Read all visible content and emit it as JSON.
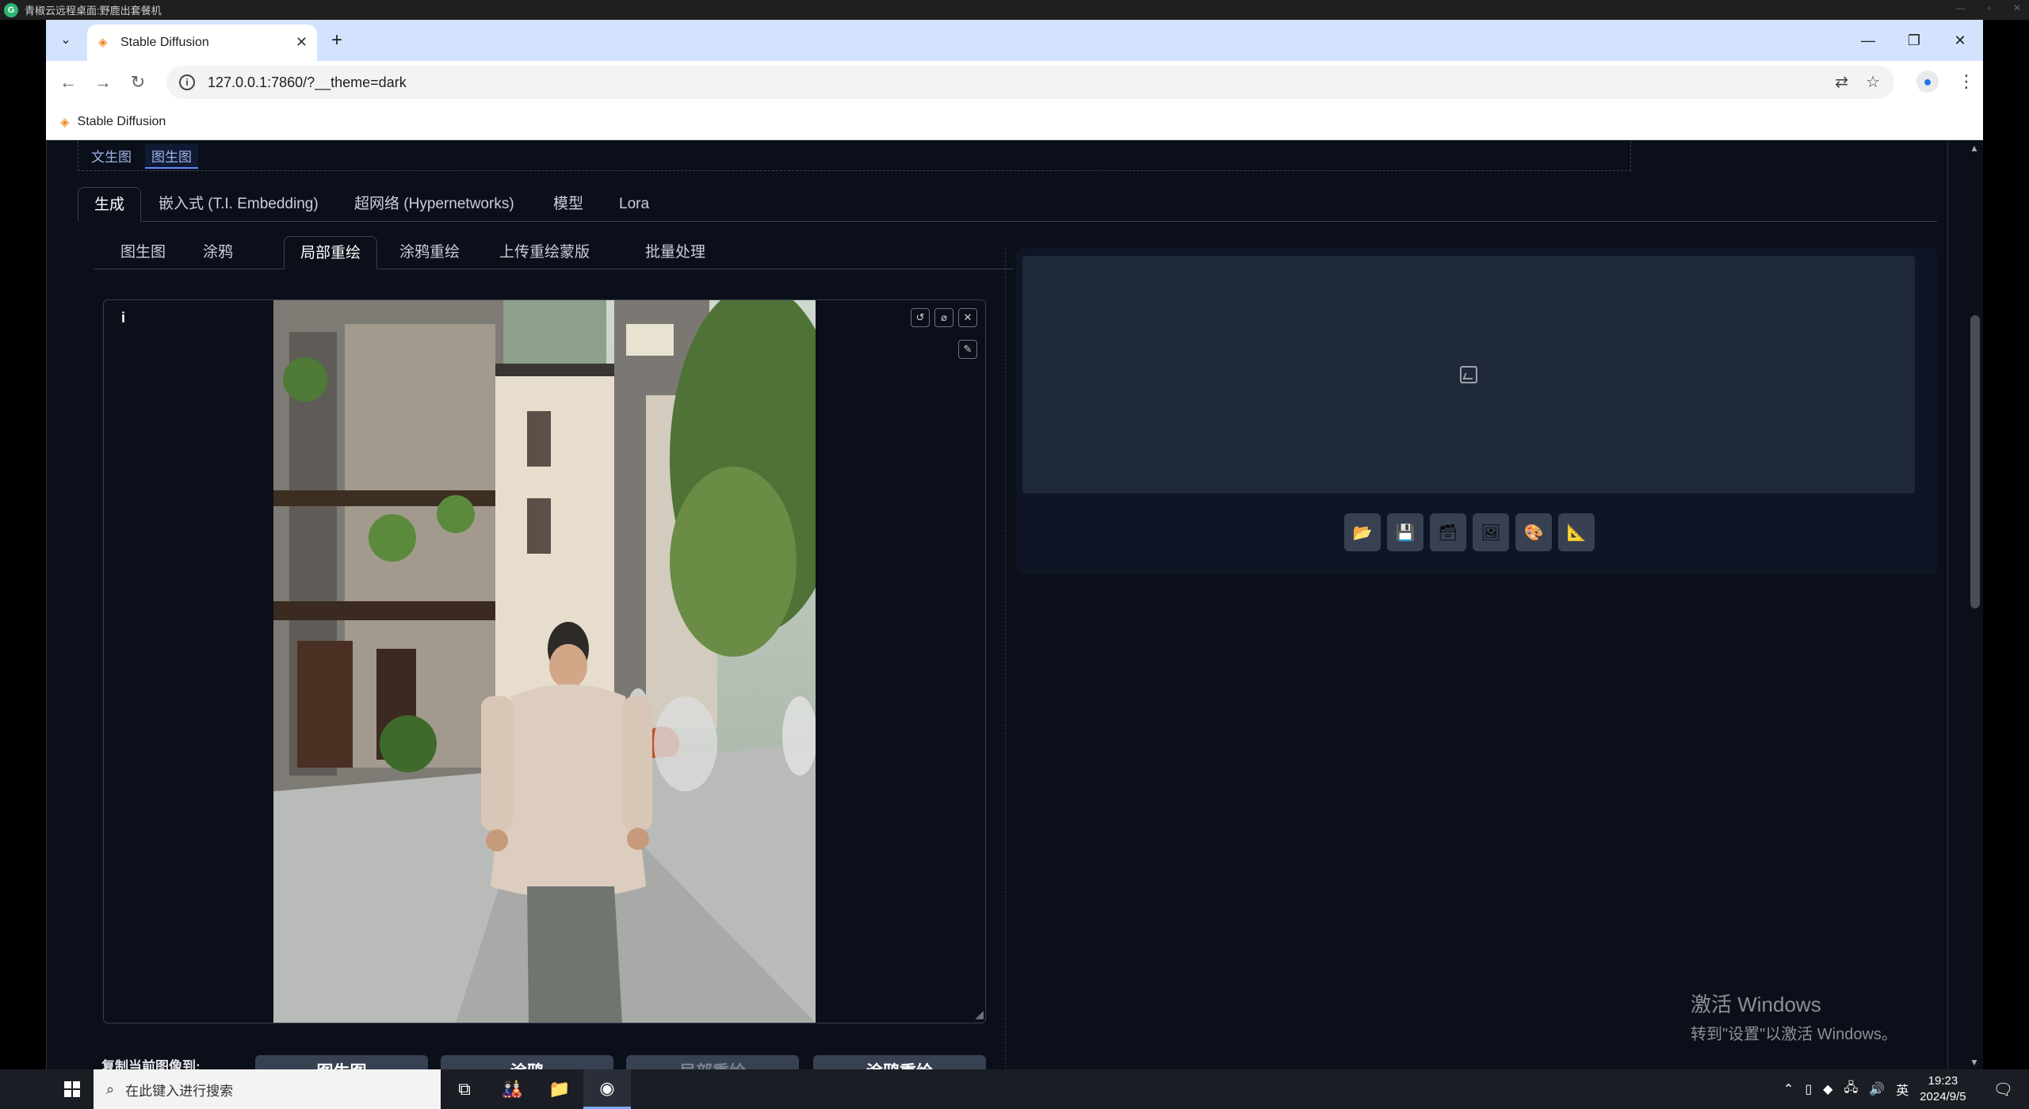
{
  "outer_window": {
    "title": "青椒云远程桌面:野鹿出套餐机",
    "logo_glyph": "G"
  },
  "browser": {
    "tab_title": "Stable Diffusion",
    "url": "127.0.0.1:7860/?__theme=dark",
    "bookmark": "Stable Diffusion"
  },
  "app": {
    "mode_tabs": [
      "文生图",
      "图生图"
    ],
    "active_mode": "图生图",
    "main_tabs": [
      "生成",
      "嵌入式 (T.I. Embedding)",
      "超网络 (Hypernetworks)",
      "模型",
      "Lora"
    ],
    "active_main_tab": "生成",
    "sub_tabs": [
      "图生图",
      "涂鸦",
      "局部重绘",
      "涂鸦重绘",
      "上传重绘蒙版",
      "批量处理"
    ],
    "active_sub_tab": "局部重绘",
    "editor": {
      "info_label": "i",
      "buttons": [
        "undo-icon",
        "clear-icon",
        "close-icon"
      ],
      "brush_icon": "brush-icon"
    },
    "copy_to": {
      "label": "复制当前图像到:",
      "buttons": [
        "图生图",
        "涂鸦",
        "局部重绘",
        "涂鸦重绘"
      ],
      "disabled": "局部重绘"
    },
    "output_buttons": [
      "folder-icon",
      "save-icon",
      "zip-icon",
      "send-to-img2img-icon",
      "send-to-inpaint-icon",
      "send-to-extras-icon"
    ]
  },
  "watermark": {
    "line1": "激活 Windows",
    "line2": "转到\"设置\"以激活 Windows。"
  },
  "taskbar": {
    "search_placeholder": "在此键入进行搜索",
    "ime": "英",
    "time": "19:23",
    "date": "2024/9/5"
  }
}
